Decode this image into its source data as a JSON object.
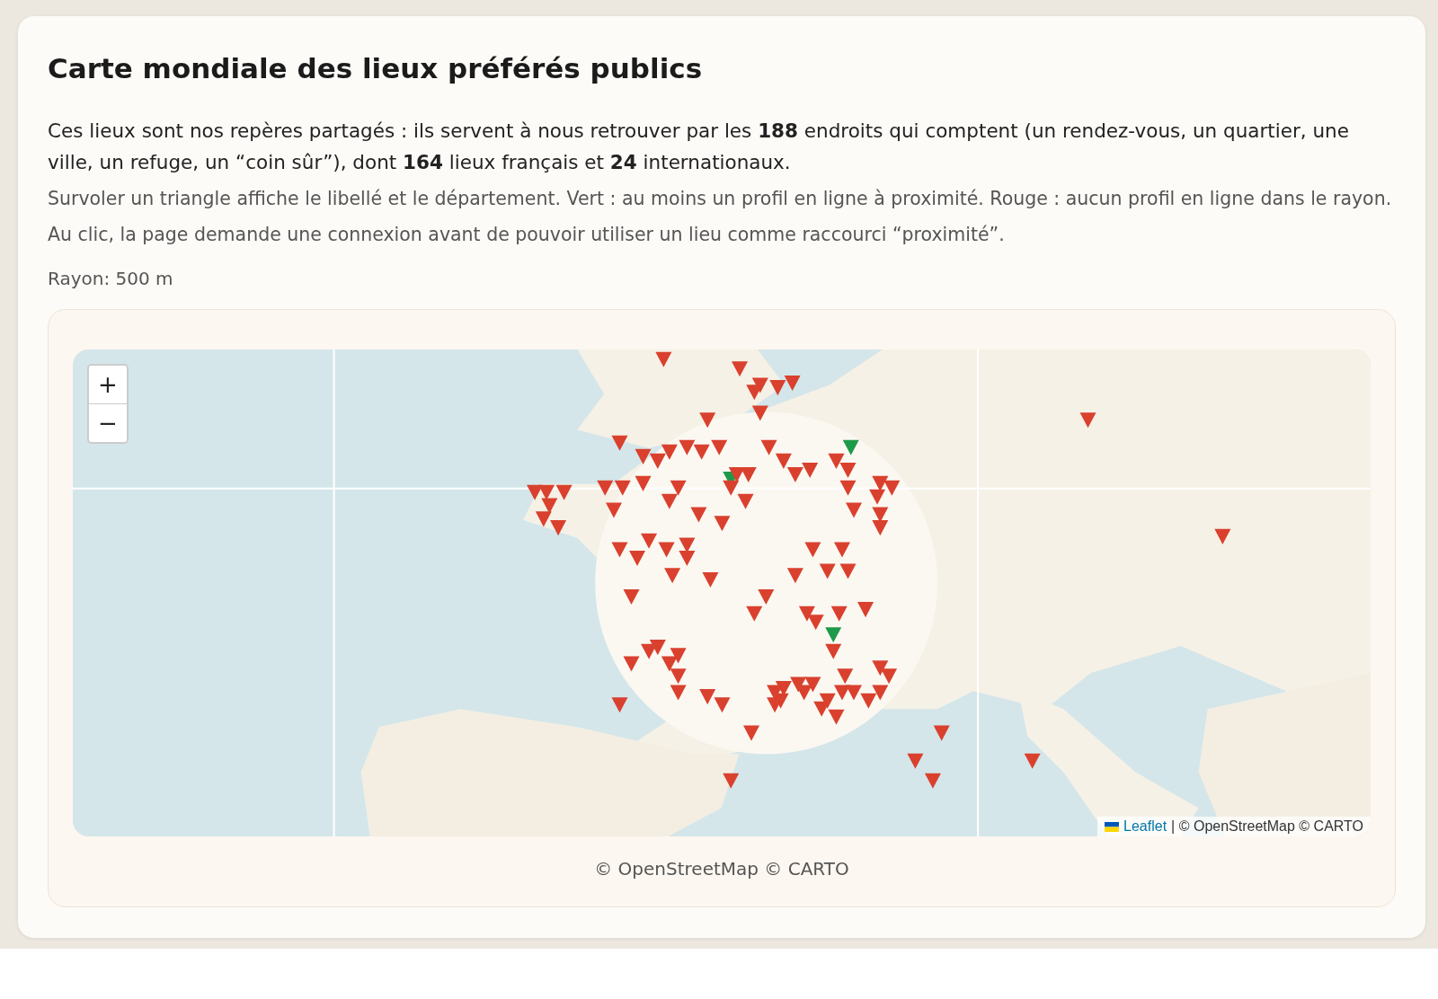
{
  "title": "Carte mondiale des lieux préférés publics",
  "intro": "Ces lieux sont nos repères partagés : ils servent à nous retrouver par les **188** endroits qui comptent (un rendez-vous, un quartier, une ville, un refuge, un “coin sûr”), dont **164** lieux français et **24** internationaux.",
  "notes": [
    "Survoler un triangle affiche le libellé et le département. Vert : au moins un profil en ligne à proximité. Rouge : aucun profil en ligne dans le rayon.",
    "Au clic, la page demande une connexion avant de pouvoir utiliser un lieu comme raccourci “proximité”."
  ],
  "radius": "Rayon: 500 m",
  "map": {
    "zoom_in": "+",
    "zoom_out": "−",
    "attribution_link": "Leaflet",
    "attribution_text": "| © OpenStreetMap © CARTO",
    "markers": [
      {
        "online": false
      },
      {
        "online": false
      },
      {
        "online": false
      },
      {
        "online": false
      },
      {
        "online": false
      },
      {
        "online": false
      },
      {
        "online": false
      },
      {
        "online": false
      },
      {
        "online": false
      },
      {
        "online": false
      },
      {
        "online": false
      },
      {
        "online": false
      },
      {
        "online": false
      },
      {
        "online": false
      },
      {
        "online": false
      },
      {
        "online": false
      },
      {
        "online": false
      },
      {
        "online": false
      },
      {
        "online": false
      },
      {
        "online": false
      },
      {
        "online": true
      },
      {
        "online": false
      },
      {
        "online": false
      },
      {
        "online": false
      },
      {
        "online": false
      },
      {
        "online": false
      },
      {
        "online": false
      },
      {
        "online": false
      },
      {
        "online": false
      },
      {
        "online": true
      },
      {
        "online": false
      },
      {
        "online": false
      },
      {
        "online": false
      },
      {
        "online": false
      },
      {
        "online": false
      },
      {
        "online": false
      },
      {
        "online": false
      },
      {
        "online": false
      },
      {
        "online": false
      },
      {
        "online": false
      },
      {
        "online": false
      },
      {
        "online": false
      },
      {
        "online": false
      },
      {
        "online": false
      },
      {
        "online": false
      },
      {
        "online": false
      },
      {
        "online": false
      },
      {
        "online": false
      },
      {
        "online": false
      },
      {
        "online": false
      },
      {
        "online": false
      },
      {
        "online": false
      },
      {
        "online": false
      },
      {
        "online": false
      },
      {
        "online": false
      },
      {
        "online": false
      },
      {
        "online": false
      },
      {
        "online": false
      },
      {
        "online": false
      },
      {
        "online": false
      },
      {
        "online": false
      },
      {
        "online": false
      },
      {
        "online": false
      },
      {
        "online": false
      },
      {
        "online": false
      },
      {
        "online": false
      },
      {
        "online": false
      },
      {
        "online": true
      },
      {
        "online": false
      },
      {
        "online": false
      },
      {
        "online": false
      },
      {
        "online": false
      },
      {
        "online": false
      },
      {
        "online": false
      },
      {
        "online": false
      },
      {
        "online": false
      },
      {
        "online": false
      },
      {
        "online": false
      },
      {
        "online": false
      },
      {
        "online": false
      },
      {
        "online": false
      },
      {
        "online": false
      },
      {
        "online": false
      },
      {
        "online": false
      },
      {
        "online": false
      },
      {
        "online": false
      },
      {
        "online": false
      },
      {
        "online": false
      },
      {
        "online": false
      },
      {
        "online": false
      },
      {
        "online": false
      },
      {
        "online": false
      },
      {
        "online": false
      },
      {
        "online": false
      },
      {
        "online": false
      },
      {
        "online": false
      },
      {
        "online": false
      },
      {
        "online": false
      },
      {
        "online": false
      },
      {
        "online": false
      },
      {
        "online": false
      },
      {
        "online": false
      },
      {
        "online": false
      },
      {
        "online": false
      },
      {
        "online": false
      }
    ]
  },
  "caption": "© OpenStreetMap © CARTO"
}
